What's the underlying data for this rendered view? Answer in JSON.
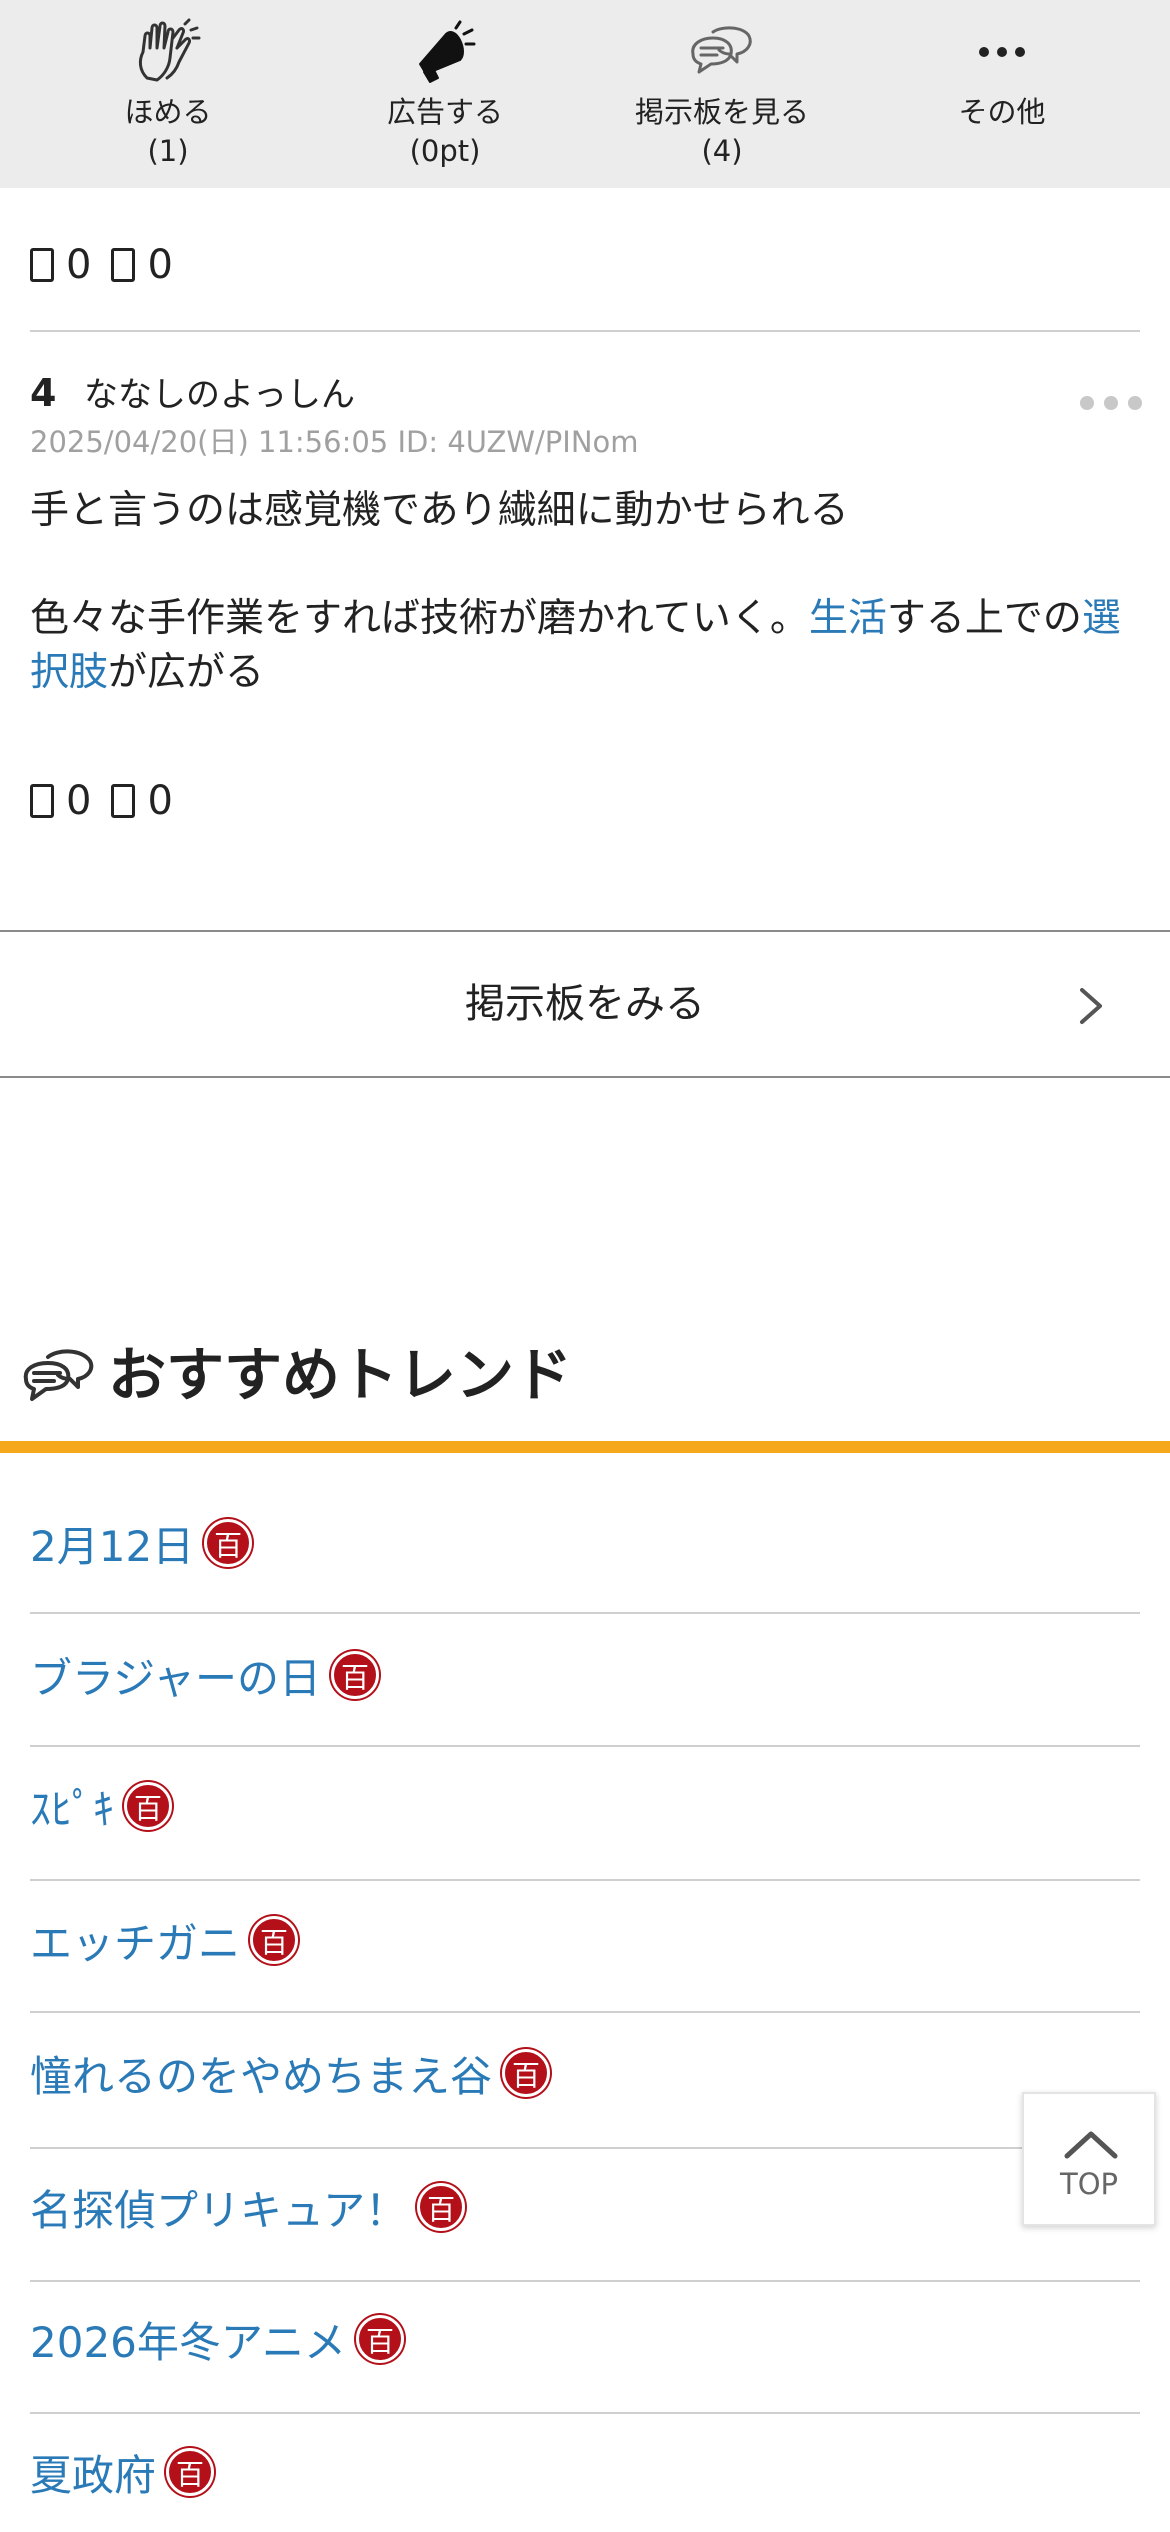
{
  "toolbar": {
    "items": [
      {
        "label": "ほめる",
        "count": "(1)",
        "icon": "clapping-hands-icon"
      },
      {
        "label": "広告する",
        "count": "(0pt)",
        "icon": "megaphone-icon"
      },
      {
        "label": "掲示板を見る",
        "count": "(4)",
        "icon": "speech-bubbles-icon"
      },
      {
        "label": "その他",
        "count": "",
        "icon": "more-dots-icon"
      }
    ]
  },
  "prev_post": {
    "reactions": {
      "up": "0",
      "down": "0"
    }
  },
  "post": {
    "number": "4",
    "author": "ななしのよっしん",
    "meta": "2025/04/20(日) 11:56:05 ID: 4UZW/PINom",
    "line1": "手と言うのは感覚機であり繊細に動かせられる",
    "line2_before": "色々な手作業をすれば技術が磨かれていく。",
    "link1": "生活",
    "line2_middle": "する上での",
    "link2": "選択肢",
    "line2_after": "が広がる",
    "reactions": {
      "up": "0",
      "down": "0"
    }
  },
  "board_button": {
    "label": "掲示板をみる"
  },
  "trends": {
    "title": "おすすめトレンド",
    "badge": "百",
    "items": [
      "2月12日",
      "ブラジャーの日",
      "ｽﾋﾟｷ",
      "エッチガニ",
      "憧れるのをやめちまえ谷",
      "名探偵プリキュア！",
      "2026年冬アニメ",
      "夏政府"
    ]
  },
  "top_button": {
    "label": "TOP"
  },
  "colors": {
    "link": "#2a7ab8",
    "accent_bar": "#f5a81c",
    "badge": "#b3101a",
    "toolbar_bg": "#ececec"
  }
}
